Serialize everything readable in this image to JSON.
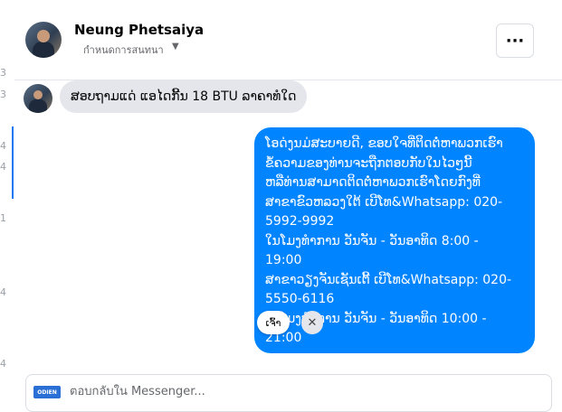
{
  "left_strip": {
    "marks": [
      "3",
      "3",
      "4",
      "4",
      "1",
      "4",
      "4"
    ]
  },
  "header": {
    "name": "Neung Phetsaiya",
    "sub_label": "กำหนดการสนทนา",
    "more_label": "···"
  },
  "messages": {
    "incoming": "ສອບຖາມແດ່ ແອໄດກີ້ນ 18 BTU ລາຄາທໍໃດ",
    "outgoing_lines": [
      "ໂອດ່ງນມ່ສະບາຍດີ, ຂອບໃຈທີ່ຕິດຕໍ່ຫາພວກເຮົາ",
      "ຂໍ້ຄວາມຂອງທ່ານຈະຖືກຕອບກັບໃນໄວໆນີ້",
      "ຫລືທ່ານສາມາດຕິດຕໍ່ຫາພວກເຮົາໂດຍກົງທີ່",
      "ສາຂາຂົວຫລວງໃຕ້ ເບີໂທ&Whatsapp: 020-",
      "5992-9992",
      "ໃນໂມງທໍາການ ວັນຈັນ - ວັນອາທິດ  8:00 -",
      "19:00",
      "ສາຂາວຽງຈັນເຊັນເຕີ້ ເບີໂທ&Whatsapp: 020-",
      "5550-6116",
      "ໃນໂມງທໍາການ ວັນຈັນ - ວັນອາທິດ  10:00 -",
      "21:00"
    ]
  },
  "quick_reply": {
    "label": "ເຈົ້າ",
    "close": "✕"
  },
  "composer": {
    "logo_text": "ODIEN",
    "placeholder": "ตอบกลับใน Messenger..."
  }
}
